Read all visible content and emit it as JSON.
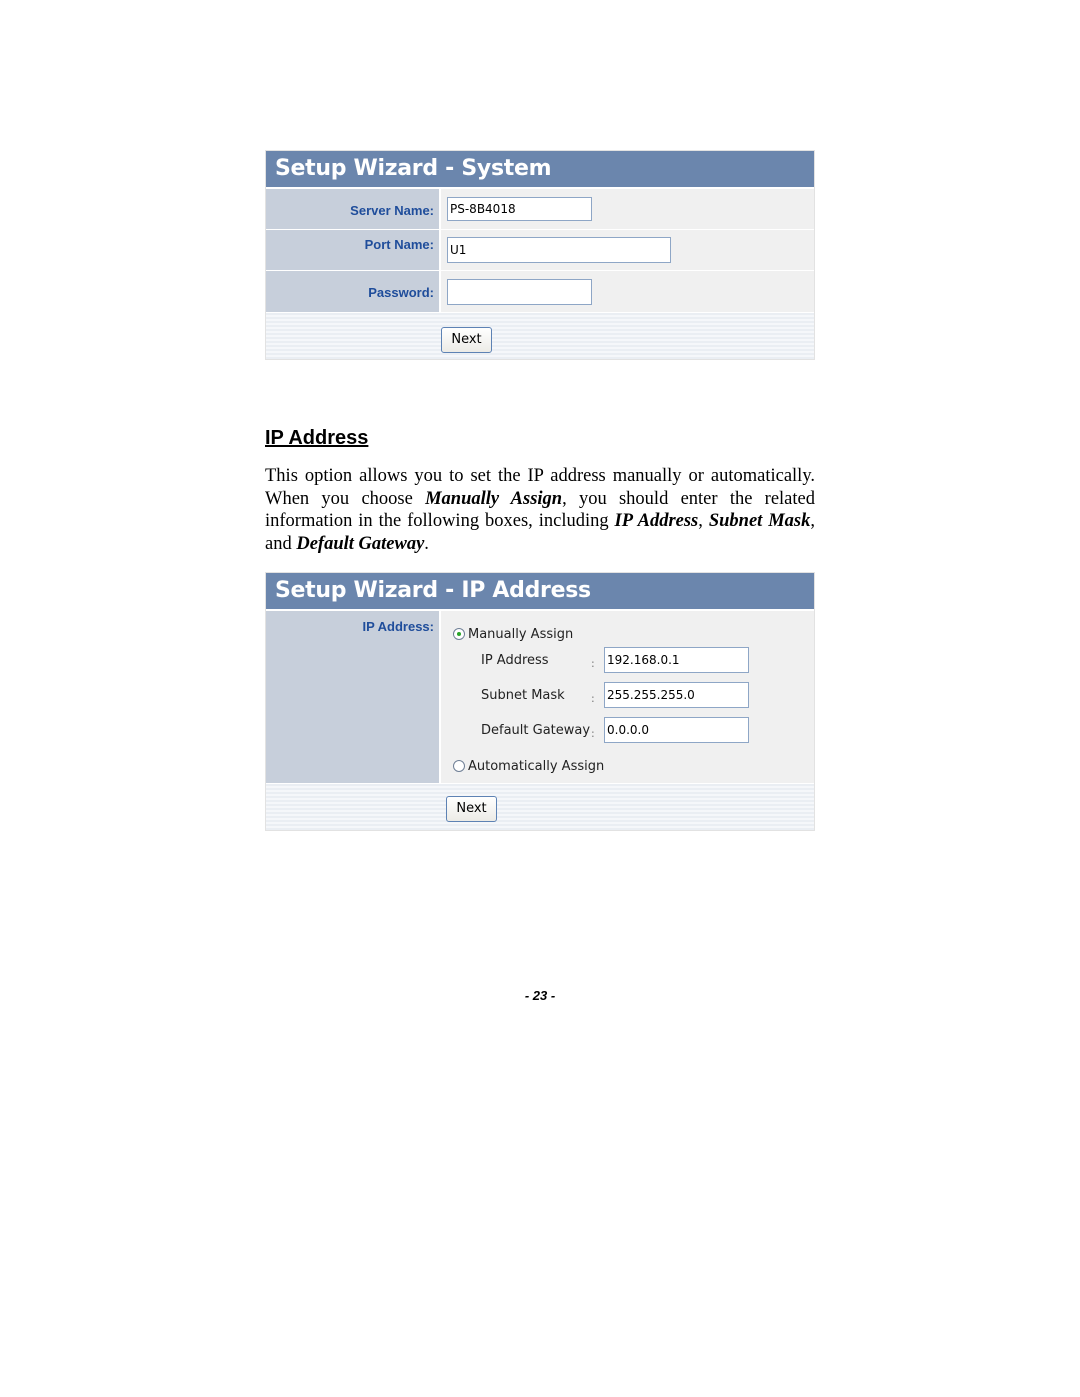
{
  "system_panel": {
    "title": "Setup Wizard - System",
    "fields": [
      {
        "label": "Server Name:",
        "value": ""
      },
      {
        "label": "Port Name:",
        "value": ""
      },
      {
        "label": "Password:",
        "value": ""
      }
    ],
    "server_name_value": "PS-8B4018",
    "port_name_value": "U1",
    "password_value": "",
    "next_label": "Next"
  },
  "section": {
    "heading": "IP Address",
    "paragraph": {
      "part1": "This option allows you to set the IP address manually or automatically.   When you choose ",
      "em1": "Manually Assign",
      "part2": ", you should enter the related information in the following boxes, including ",
      "em2": "IP Address",
      "part3": ", ",
      "em3": "Subnet Mask",
      "part4": ", and ",
      "em4": "Default Gateway",
      "part5": "."
    }
  },
  "ip_panel": {
    "title": "Setup Wizard - IP Address",
    "row_label": "IP Address:",
    "manual_option": "Manually Assign",
    "manual_selected": true,
    "auto_option": "Automatically Assign",
    "auto_selected": false,
    "ip_address_label": "IP Address",
    "ip_address_value": "192.168.0.1",
    "subnet_mask_label": "Subnet Mask",
    "subnet_mask_value": "255.255.255.0",
    "gateway_label": "Default Gateway",
    "gateway_value": "0.0.0.0",
    "colon": ":",
    "next_label": "Next"
  },
  "footer": {
    "page_number": "- 23 -"
  },
  "colors": {
    "header_bg": "#6b86ad",
    "label_bg": "#c7cfdb",
    "label_text": "#1f4d9b",
    "field_bg": "#f0f0f0"
  }
}
